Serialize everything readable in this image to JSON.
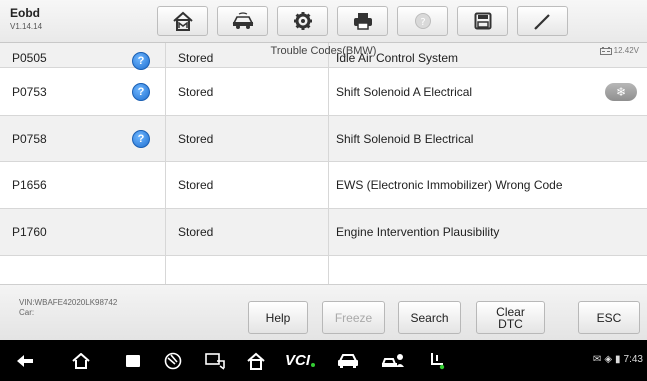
{
  "app": {
    "title": "Eobd",
    "version": "V1.14.14"
  },
  "toolbar": {
    "buttons": [
      {
        "name": "home-icon"
      },
      {
        "name": "vehicle-icon"
      },
      {
        "name": "settings-icon"
      },
      {
        "name": "print-icon"
      },
      {
        "name": "help-icon"
      },
      {
        "name": "save-icon"
      },
      {
        "name": "edit-icon"
      }
    ]
  },
  "header": {
    "subtitle": "Trouble Codes(BMW)",
    "battery": "12.42V"
  },
  "table": {
    "rows": [
      {
        "code": "P0505",
        "help": true,
        "status": "Stored",
        "description": "Idle Air Control System",
        "freeze": false
      },
      {
        "code": "P0753",
        "help": true,
        "status": "Stored",
        "description": "Shift Solenoid A Electrical",
        "freeze": true
      },
      {
        "code": "P0758",
        "help": true,
        "status": "Stored",
        "description": "Shift Solenoid B Electrical",
        "freeze": false
      },
      {
        "code": "P1656",
        "help": false,
        "status": "Stored",
        "description": "EWS (Electronic Immobilizer) Wrong Code",
        "freeze": false
      },
      {
        "code": "P1760",
        "help": false,
        "status": "Stored",
        "description": "Engine Intervention Plausibility",
        "freeze": false
      },
      {
        "code": "",
        "help": true,
        "status": "",
        "description": "",
        "freeze": false
      }
    ]
  },
  "footer": {
    "vin": "VIN:WBAFE42020LK98742",
    "car": "Car:",
    "buttons": {
      "help": "Help",
      "freeze": "Freeze",
      "search": "Search",
      "clear_line1": "Clear",
      "clear_line2": "DTC",
      "esc": "ESC"
    }
  },
  "navbar": {
    "vcl_label": "VCI",
    "time": "7:43"
  }
}
